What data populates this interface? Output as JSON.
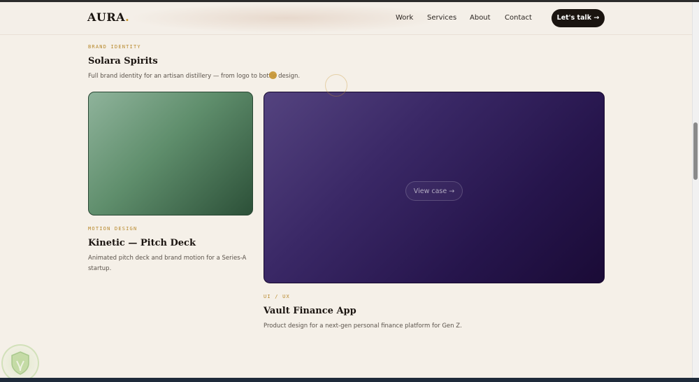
{
  "header": {
    "logo": {
      "text": "AURA",
      "dot": "."
    },
    "nav": [
      "Work",
      "Services",
      "About",
      "Contact"
    ],
    "cta_label": "Let's talk →"
  },
  "projects": [
    {
      "tag": "BRAND IDENTITY",
      "title": "Solara Spirits",
      "description": "Full brand identity for an artisan distillery — from logo to bottle design."
    },
    {
      "tag": "MOTION DESIGN",
      "title": "Kinetic — Pitch Deck",
      "description_lines": [
        "Animated pitch deck and brand motion for a Series-A",
        "startup."
      ]
    },
    {
      "tag": "UI / UX",
      "title": "Vault Finance App",
      "description": "Product design for a next-gen personal finance platform for Gen Z.",
      "button_label": "View case →"
    }
  ],
  "colors": {
    "background": "#f5f0e8",
    "accent": "#c8962e",
    "text": "#1a1410",
    "card_green": "#5f8e6c",
    "card_purple": "#2c1a58"
  },
  "icons": {
    "badge": "shield-leaf-icon"
  }
}
